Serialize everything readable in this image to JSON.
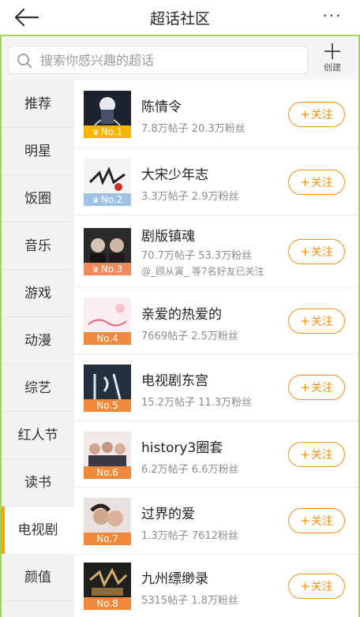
{
  "header": {
    "title": "超话社区",
    "back_icon": "back-arrow-icon",
    "more_label": "···"
  },
  "search": {
    "placeholder": "搜索你感兴趣的超话",
    "create_label": "创建"
  },
  "colors": {
    "accent": "#f29318",
    "frame": "#a6d25a",
    "sidebar_indicator": "#f7a700"
  },
  "sidebar": {
    "items": [
      {
        "label": "推荐"
      },
      {
        "label": "明星"
      },
      {
        "label": "饭圈"
      },
      {
        "label": "音乐"
      },
      {
        "label": "游戏"
      },
      {
        "label": "动漫"
      },
      {
        "label": "综艺"
      },
      {
        "label": "红人节"
      },
      {
        "label": "读书"
      },
      {
        "label": "电视剧",
        "active": true
      },
      {
        "label": "颜值"
      }
    ]
  },
  "follow_label": "关注",
  "topics": [
    {
      "rank": "No.1",
      "name": "陈情令",
      "stats": "7.8万帖子 20.3万粉丝",
      "rank_color": "#f5b500",
      "crown": true
    },
    {
      "rank": "No.2",
      "name": "大宋少年志",
      "stats": "3.3万帖子 2.9万粉丝",
      "rank_color": "#9fc2e4",
      "crown": true
    },
    {
      "rank": "No.3",
      "name": "剧版镇魂",
      "stats": "70.7万帖子 53.3万粉丝",
      "friends": "@_顾从寅_ 等7名好友已关注",
      "rank_color": "#f08a5d",
      "crown": true
    },
    {
      "rank": "No.4",
      "name": "亲爱的热爱的",
      "stats": "7669帖子 2.5万粉丝",
      "rank_color": "#ef8a3c",
      "crown": false
    },
    {
      "rank": "No.5",
      "name": "电视剧东宫",
      "stats": "15.2万帖子 11.3万粉丝",
      "rank_color": "#ef8a3c",
      "crown": false
    },
    {
      "rank": "No.6",
      "name": "history3圈套",
      "stats": "6.2万帖子 6.6万粉丝",
      "rank_color": "#ef8a3c",
      "crown": false
    },
    {
      "rank": "No.7",
      "name": "过界的爱",
      "stats": "1.3万帖子 7612粉丝",
      "rank_color": "#ef8a3c",
      "crown": false
    },
    {
      "rank": "No.8",
      "name": "九州缥缈录",
      "stats": "5315帖子 1.8万粉丝",
      "rank_color": "#ef8a3c",
      "crown": false
    }
  ]
}
